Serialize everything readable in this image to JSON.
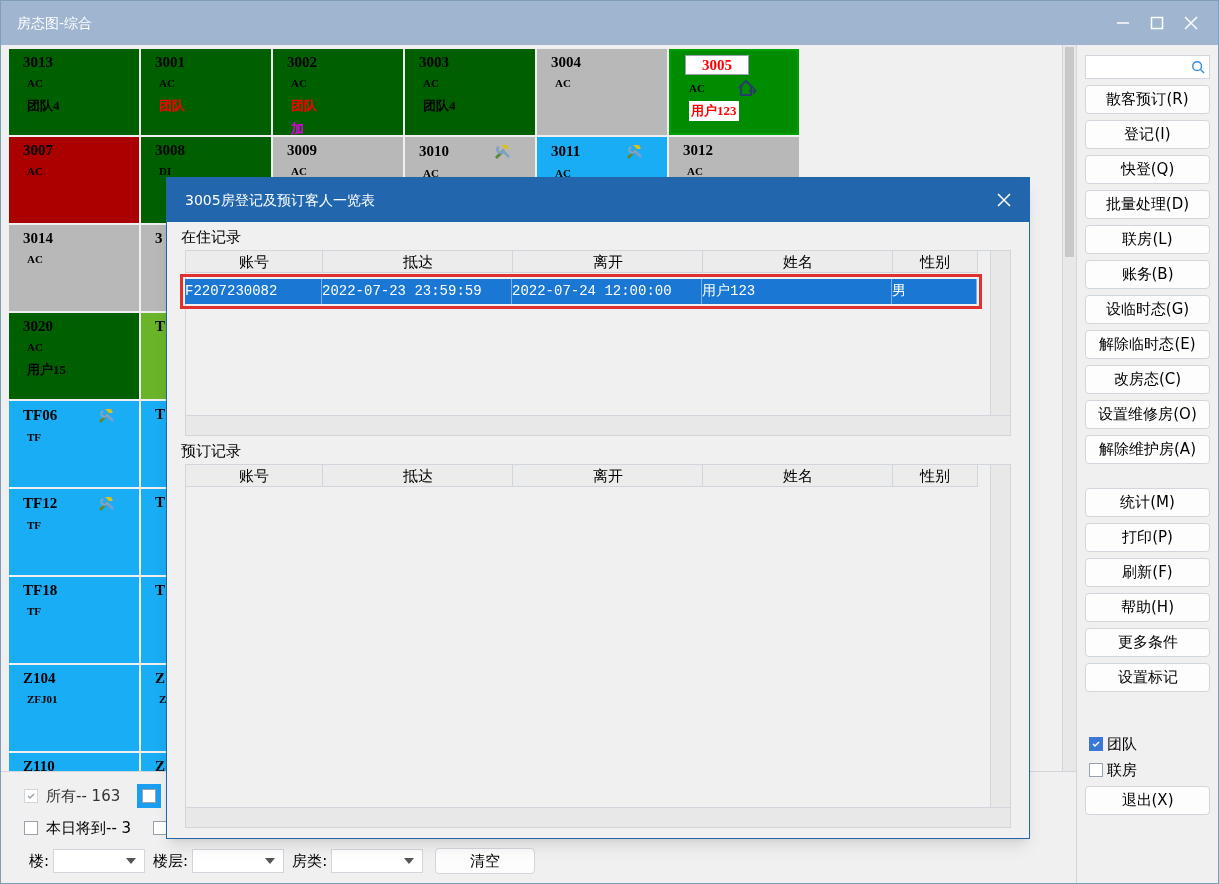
{
  "window": {
    "title": "房态图-综合"
  },
  "room_rows": [
    {
      "cells": [
        {
          "number": "3013",
          "color": "#006000",
          "selected": false,
          "lines": [
            {
              "text": "AC",
              "color": "#000000"
            },
            {
              "text": "团队4",
              "color": "#000000"
            }
          ]
        },
        {
          "number": "3001",
          "color": "#006000",
          "selected": false,
          "lines": [
            {
              "text": "AC",
              "color": "#000000"
            },
            {
              "text": "团队",
              "color": "#ff0000"
            }
          ]
        },
        {
          "number": "3002",
          "color": "#006000",
          "selected": false,
          "lines": [
            {
              "text": "AC",
              "color": "#000000"
            },
            {
              "text": "团队",
              "color": "#ff0000"
            },
            {
              "text": "加",
              "color": "#e000e0"
            }
          ]
        },
        {
          "number": "3003",
          "color": "#006000",
          "selected": false,
          "lines": [
            {
              "text": "AC",
              "color": "#000000"
            },
            {
              "text": "团队4",
              "color": "#000000"
            }
          ]
        },
        {
          "number": "3004",
          "color": "#b8b8b8",
          "selected": false,
          "lines": [
            {
              "text": "AC",
              "color": "#000000"
            }
          ]
        },
        {
          "number": "3005",
          "color": "#008c00",
          "selected": true,
          "kind": "occupied",
          "lines": [
            {
              "text": "AC",
              "color": "#000000"
            },
            {
              "text": "用户123",
              "color": "#ff0000"
            }
          ]
        }
      ]
    },
    {
      "cells": [
        {
          "number": "3007",
          "color": "#aa0000",
          "selected": false,
          "lines": [
            {
              "text": "AC",
              "color": "#000000"
            }
          ]
        },
        {
          "number": "3008",
          "color": "#006000",
          "selected": false,
          "lines": [
            {
              "text": "DI",
              "color": "#000000"
            }
          ]
        },
        {
          "number": "3009",
          "color": "#b8b8b8",
          "selected": false,
          "lines": [
            {
              "text": "AC",
              "color": "#000000"
            }
          ]
        },
        {
          "number": "3010",
          "color": "#b8b8b8",
          "selected": false,
          "kind": "repair",
          "lines": [
            {
              "text": "AC",
              "color": "#000000"
            }
          ]
        },
        {
          "number": "3011",
          "color": "#19adf5",
          "selected": false,
          "kind": "repair",
          "lines": [
            {
              "text": "AC",
              "color": "#000000"
            }
          ]
        },
        {
          "number": "3012",
          "color": "#b8b8b8",
          "selected": false,
          "lines": [
            {
              "text": "AC",
              "color": "#000000"
            }
          ]
        }
      ]
    },
    {
      "cells": [
        {
          "number": "3014",
          "color": "#b8b8b8",
          "selected": false,
          "lines": [
            {
              "text": "AC",
              "color": "#000000"
            }
          ]
        },
        {
          "number": "3",
          "color": "#b8b8b8",
          "selected": false
        }
      ]
    },
    {
      "cells": [
        {
          "number": "3020",
          "color": "#006000",
          "selected": false,
          "lines": [
            {
              "text": "AC",
              "color": "#000000"
            },
            {
              "text": "用户15",
              "color": "#000000"
            }
          ]
        },
        {
          "number": "T",
          "color": "#6ab42a",
          "selected": false
        }
      ]
    },
    {
      "cells": [
        {
          "number": "TF06",
          "color": "#19adf5",
          "selected": false,
          "kind": "repair",
          "lines": [
            {
              "text": "TF",
              "color": "#000000"
            }
          ]
        },
        {
          "number": "T",
          "color": "#19adf5",
          "selected": false
        }
      ]
    },
    {
      "cells": [
        {
          "number": "TF12",
          "color": "#19adf5",
          "selected": false,
          "kind": "repair",
          "lines": [
            {
              "text": "TF",
              "color": "#000000"
            }
          ]
        },
        {
          "number": "T",
          "color": "#19adf5",
          "selected": false
        }
      ]
    },
    {
      "cells": [
        {
          "number": "TF18",
          "color": "#19adf5",
          "selected": false,
          "lines": [
            {
              "text": "TF",
              "color": "#000000"
            }
          ]
        },
        {
          "number": "T",
          "color": "#19adf5",
          "selected": false
        }
      ]
    },
    {
      "cells": [
        {
          "number": "Z104",
          "color": "#19adf5",
          "selected": false,
          "lines": [
            {
              "text": "ZFJ01",
              "color": "#000000"
            }
          ]
        },
        {
          "number": "Z",
          "color": "#19adf5",
          "selected": false,
          "lines": [
            {
              "text": "Z",
              "color": "#000000"
            }
          ]
        }
      ]
    },
    {
      "cells": [
        {
          "number": "Z110",
          "color": "#19adf5",
          "selected": false
        },
        {
          "number": "Z",
          "color": "#19adf5",
          "selected": false
        }
      ]
    }
  ],
  "filters": {
    "row_1": [
      {
        "label": "所有-- 163",
        "checked": true,
        "disabled": true,
        "highlighted": false
      },
      {
        "checked": false,
        "highlighted": true
      }
    ],
    "row_2": [
      {
        "label": "本日将到-- 3",
        "checked": false,
        "highlighted": false
      },
      {
        "checked": false,
        "highlighted": false
      }
    ],
    "selects": [
      {
        "label": "楼:"
      },
      {
        "label": "楼层:"
      },
      {
        "label": "房类:"
      }
    ],
    "clear_button": "清空"
  },
  "dialog": {
    "title": "3005房登记及预订客人一览表",
    "in_house": {
      "title": "在住记录",
      "columns": [
        "账号",
        "抵达",
        "离开",
        "姓名",
        "性别"
      ],
      "rows": [
        {
          "selected": true,
          "cells": [
            "F2207230082",
            "2022-07-23 23:59:59",
            "2022-07-24 12:00:00",
            "用户123",
            "男"
          ]
        }
      ]
    },
    "reservations": {
      "title": "预订记录",
      "columns": [
        "账号",
        "抵达",
        "离开",
        "姓名",
        "性别"
      ]
    }
  },
  "sidebar": {
    "buttons_top": [
      "散客预订(R)",
      "登记(I)",
      "快登(Q)",
      "批量处理(D)",
      "联房(L)",
      "账务(B)",
      "设临时态(G)",
      "解除临时态(E)",
      "改房态(C)",
      "设置维修房(O)",
      "解除维护房(A)"
    ],
    "buttons_bottom": [
      "统计(M)",
      "打印(P)",
      "刷新(F)",
      "帮助(H)",
      "更多条件",
      "设置标记"
    ],
    "checkboxes": [
      {
        "label": "团队",
        "checked": true
      },
      {
        "label": "联房",
        "checked": false
      }
    ],
    "exit_button": "退出(X)"
  }
}
